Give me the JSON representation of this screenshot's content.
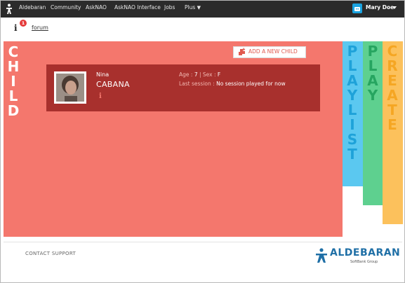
{
  "topnav": {
    "items": [
      "Aldebaran",
      "Community",
      "AskNAO",
      "AskNAO Interface",
      "Jobs",
      "Plus"
    ],
    "user_name": "Mary Doe"
  },
  "subbar": {
    "notification_count": "1",
    "forum_link": "forum"
  },
  "child_section": {
    "title_letters": [
      "C",
      "H",
      "I",
      "L",
      "D"
    ],
    "add_button_label": "ADD A NEW CHILD",
    "child": {
      "first_name": "Nina",
      "last_name": "CABANA",
      "age_label": "Age :",
      "age": "7",
      "sex_label": "| Sex :",
      "sex": "F",
      "session_label": "Last session :",
      "session_value": "No session played for now"
    }
  },
  "side_panels": {
    "playlist_letters": [
      "P",
      "L",
      "A",
      "Y",
      "L",
      "I",
      "S",
      "T"
    ],
    "play_letters": [
      "P",
      "L",
      "A",
      "Y"
    ],
    "create_letters": [
      "C",
      "R",
      "E",
      "A",
      "T",
      "E"
    ]
  },
  "colors": {
    "child": "#f4776d",
    "card": "#a8302d",
    "playlist": "#5bc8f0",
    "play": "#5ed08f",
    "create": "#fcc15c"
  },
  "footer": {
    "contact": "CONTACT SUPPORT",
    "logo_text": "ALDEBARAN",
    "logo_sub": "SoftBank Group"
  }
}
